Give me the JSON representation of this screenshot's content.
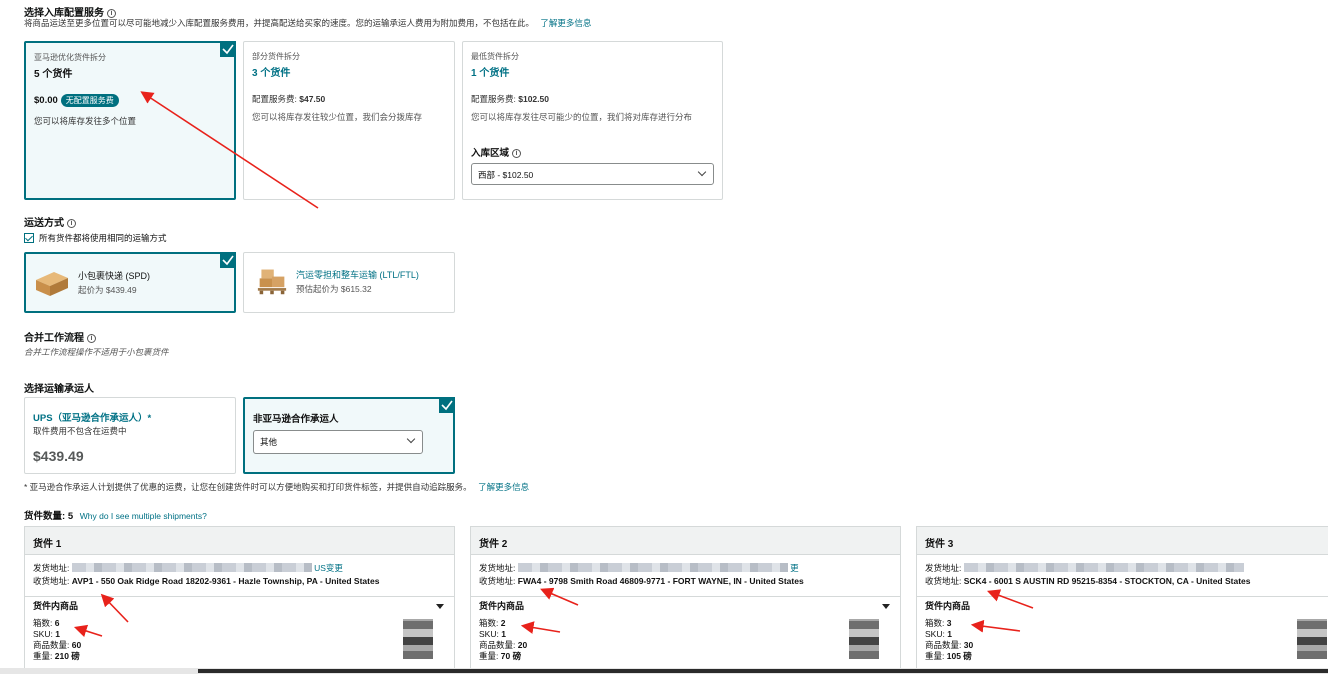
{
  "placement": {
    "title": "选择入库配置服务",
    "desc": "将商品运送至更多位置可以尽可能地减少入库配置服务费用，并提高配送给买家的速度。您的运输承运人费用为附加费用，不包括在此。",
    "desc_link": "了解更多信息",
    "options": [
      {
        "label": "亚马逊优化货件拆分",
        "count": "5 个货件",
        "price": "$0.00",
        "badge": "无配置服务费",
        "note": "您可以将库存发往多个位置",
        "selected": true
      },
      {
        "label": "部分货件拆分",
        "count": "3 个货件",
        "price_label": "配置服务费: ",
        "price": "$47.50",
        "note": "您可以将库存发往较少位置，我们会分拨库存",
        "selected": false
      },
      {
        "label": "最低货件拆分",
        "count": "1 个货件",
        "price_label": "配置服务费: ",
        "price": "$102.50",
        "note": "您可以将库存发往尽可能少的位置，我们将对库存进行分布",
        "region_label": "入库区域",
        "region_value": "西部 - $102.50",
        "selected": false
      }
    ]
  },
  "shipping": {
    "title": "运送方式",
    "same_method": "所有货件都将使用相同的运输方式",
    "options": [
      {
        "name": "小包裹快递 (SPD)",
        "price": "起价为 $439.49",
        "selected": true
      },
      {
        "name": "汽运零担和整车运输 (LTL/FTL)",
        "price": "预估起价为 $615.32",
        "selected": false
      }
    ]
  },
  "workflow": {
    "title": "合并工作流程",
    "note": "合并工作流程操作不适用于小包裹货件"
  },
  "carrier": {
    "title": "选择运输承运人",
    "ups_title": "UPS（亚马逊合作承运人）*",
    "ups_note": "取件费用不包含在运费中",
    "ups_price": "$439.49",
    "non_title": "非亚马逊合作承运人",
    "non_value": "其他",
    "footnote": "* 亚马逊合作承运人计划提供了优惠的运费，让您在创建货件时可以方便地购买和打印货件标签，并提供自动追踪服务。",
    "footnote_link": "了解更多信息"
  },
  "shipments_count": {
    "label": "货件数量:",
    "value": "5",
    "link": "Why do I see multiple shipments?"
  },
  "shipments": [
    {
      "title": "货件 1",
      "from_label": "发货地址:",
      "from_suffix": "US变更",
      "to_label": "收货地址:",
      "to_code": "AVP1",
      "to_addr": " - 550 Oak Ridge Road 18202-9361 - Hazle Township, PA - United States",
      "items_label": "货件内商品",
      "boxes_label": "箱数:",
      "boxes": "6",
      "sku_label": "SKU:",
      "sku": "1",
      "qty_label": "商品数量:",
      "qty": "60",
      "weight_label": "重量:",
      "weight": "210 磅"
    },
    {
      "title": "货件 2",
      "from_label": "发货地址:",
      "from_suffix": "更",
      "to_label": "收货地址:",
      "to_code": "FWA4",
      "to_addr": " - 9798 Smith Road 46809-9771 - FORT WAYNE, IN - United States",
      "items_label": "货件内商品",
      "boxes_label": "箱数:",
      "boxes": "2",
      "sku_label": "SKU:",
      "sku": "1",
      "qty_label": "商品数量:",
      "qty": "20",
      "weight_label": "重量:",
      "weight": "70 磅"
    },
    {
      "title": "货件 3",
      "from_label": "发货地址:",
      "from_suffix": "",
      "to_label": "收货地址:",
      "to_code": "SCK4",
      "to_addr": " - 6001 S AUSTIN RD 95215-8354 - STOCKTON, CA - United States",
      "items_label": "货件内商品",
      "boxes_label": "箱数:",
      "boxes": "3",
      "sku_label": "SKU:",
      "sku": "1",
      "qty_label": "商品数量:",
      "qty": "30",
      "weight_label": "重量:",
      "weight": "105 磅"
    }
  ],
  "colors": {
    "accent": "#00707f",
    "link": "#007185",
    "annotation": "#e8221b"
  }
}
